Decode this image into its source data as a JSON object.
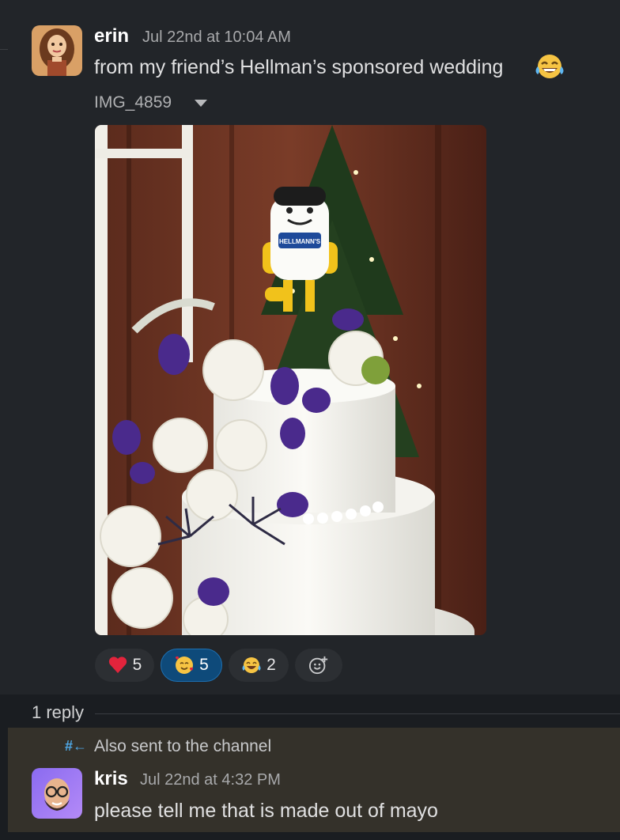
{
  "message": {
    "author": "erin",
    "timestamp": "Jul 22nd at 10:04 AM",
    "text": "from my friend’s Hellman’s sponsored wedding",
    "file_label": "IMG_4859",
    "photo_bottle_text": "HELLMANN'S",
    "reactions": [
      {
        "emoji": "red-heart",
        "count": "5",
        "selected": false
      },
      {
        "emoji": "smiling-face-with-hearts",
        "count": "5",
        "selected": true
      },
      {
        "emoji": "face-with-tears-of-joy",
        "count": "2",
        "selected": false
      }
    ]
  },
  "thread": {
    "reply_count": "1 reply"
  },
  "reply": {
    "also_sent_icon": "#←",
    "also_sent": "Also sent to the channel",
    "author": "kris",
    "timestamp": "Jul 22nd at 4:32 PM",
    "text": "please tell me that is made out of mayo"
  },
  "colors": {
    "background": "#1a1d21",
    "message_bg": "#222529",
    "reply_bg": "#34312a",
    "selected_reaction": "#0e4a7a"
  }
}
